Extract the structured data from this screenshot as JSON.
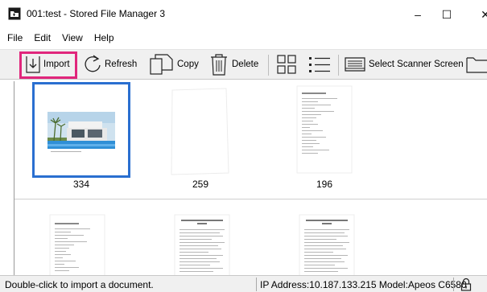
{
  "window": {
    "title": "001:test - Stored File Manager 3",
    "minimize": "–",
    "maximize": "☐",
    "close": "✕"
  },
  "menu": [
    "File",
    "Edit",
    "View",
    "Help"
  ],
  "toolbar": {
    "import_label": "Import",
    "refresh_label": "Refresh",
    "copy_label": "Copy",
    "delete_label": "Delete",
    "select_scanner_label": "Select Scanner Screen"
  },
  "documents": [
    {
      "label": "334",
      "kind": "photo",
      "selected": true
    },
    {
      "label": "259",
      "kind": "blank",
      "selected": false
    },
    {
      "label": "196",
      "kind": "text",
      "selected": false
    },
    {
      "label": "",
      "kind": "text",
      "selected": false
    },
    {
      "label": "",
      "kind": "text-heading",
      "selected": false
    },
    {
      "label": "",
      "kind": "text-heading",
      "selected": false
    }
  ],
  "status": {
    "hint": "Double-click to import a document.",
    "info": "IP Address:10.187.133.215 Model:Apeos C6580"
  },
  "colors": {
    "highlight": "#e0267c",
    "selection": "#2a6fd0"
  }
}
